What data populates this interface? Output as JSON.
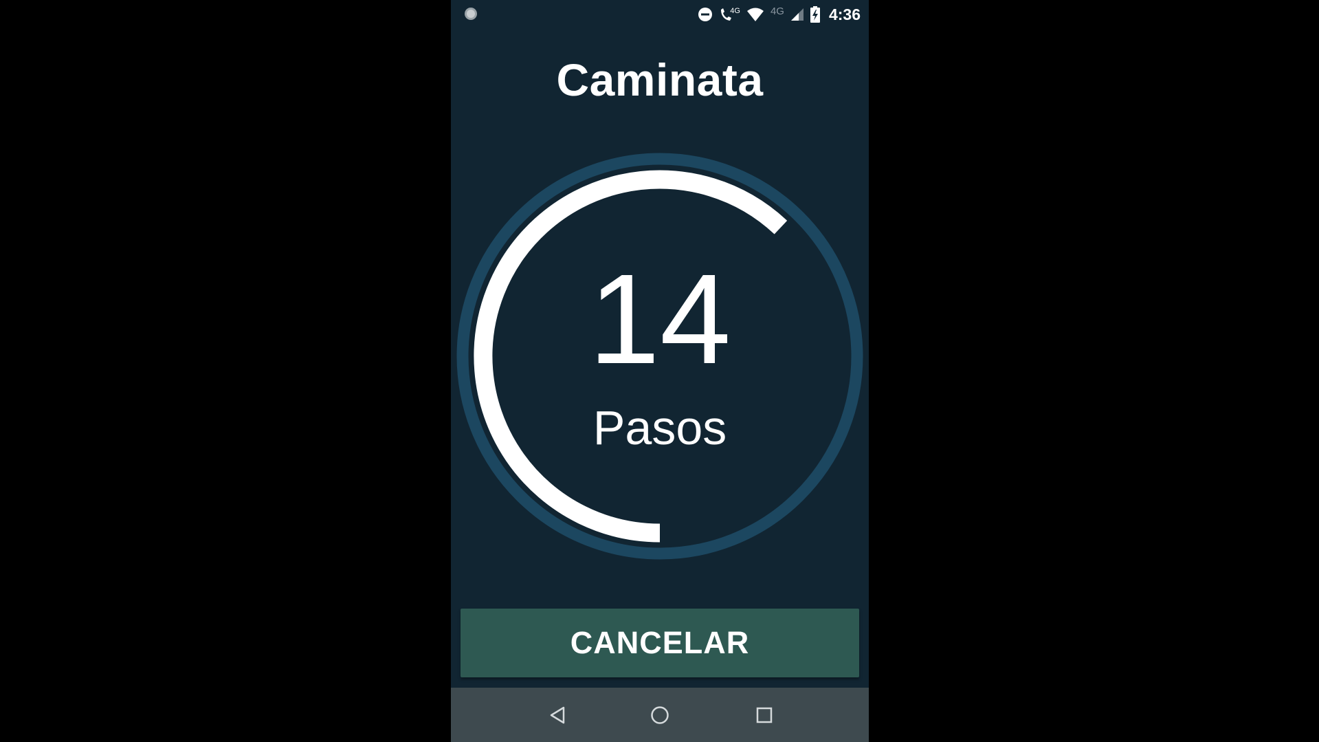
{
  "status_bar": {
    "time": "4:36",
    "network_call_label": "4G",
    "network_label": "4G",
    "icons": [
      "notification-dot-icon",
      "do-not-disturb-icon",
      "volte-call-icon",
      "wifi-icon",
      "signal-icon",
      "battery-charging-icon"
    ]
  },
  "screen": {
    "title": "Caminata",
    "step_count": "14",
    "step_label": "Pasos",
    "progress_fraction": 0.62
  },
  "actions": {
    "cancel_label": "CANCELAR"
  },
  "nav_bar": {
    "icons": [
      "back-icon",
      "home-icon",
      "recents-icon"
    ]
  },
  "colors": {
    "background": "#112532",
    "ring_track": "#1c4760",
    "ring_progress": "#ffffff",
    "button": "#2e5952",
    "nav_bar": "#3e4a4f"
  }
}
